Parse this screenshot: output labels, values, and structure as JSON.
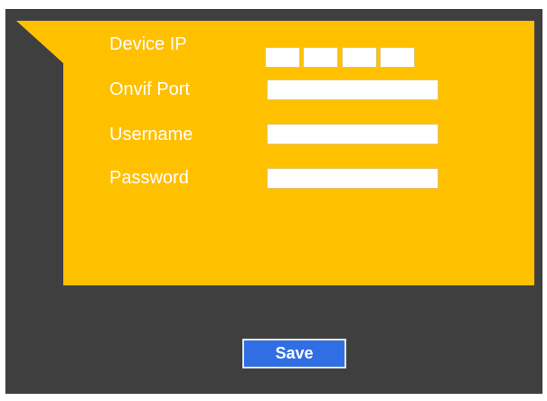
{
  "form": {
    "device_ip_label": "Device IP",
    "device_ip_octets": [
      "",
      "",
      "",
      ""
    ],
    "onvif_port_label": "Onvif Port",
    "onvif_port_value": "",
    "username_label": "Username",
    "username_value": "",
    "password_label": "Password",
    "password_value": ""
  },
  "actions": {
    "save_label": "Save"
  },
  "colors": {
    "panel": "#ffc000",
    "background": "#3f3f3f",
    "save_button": "#2f6fe3"
  }
}
